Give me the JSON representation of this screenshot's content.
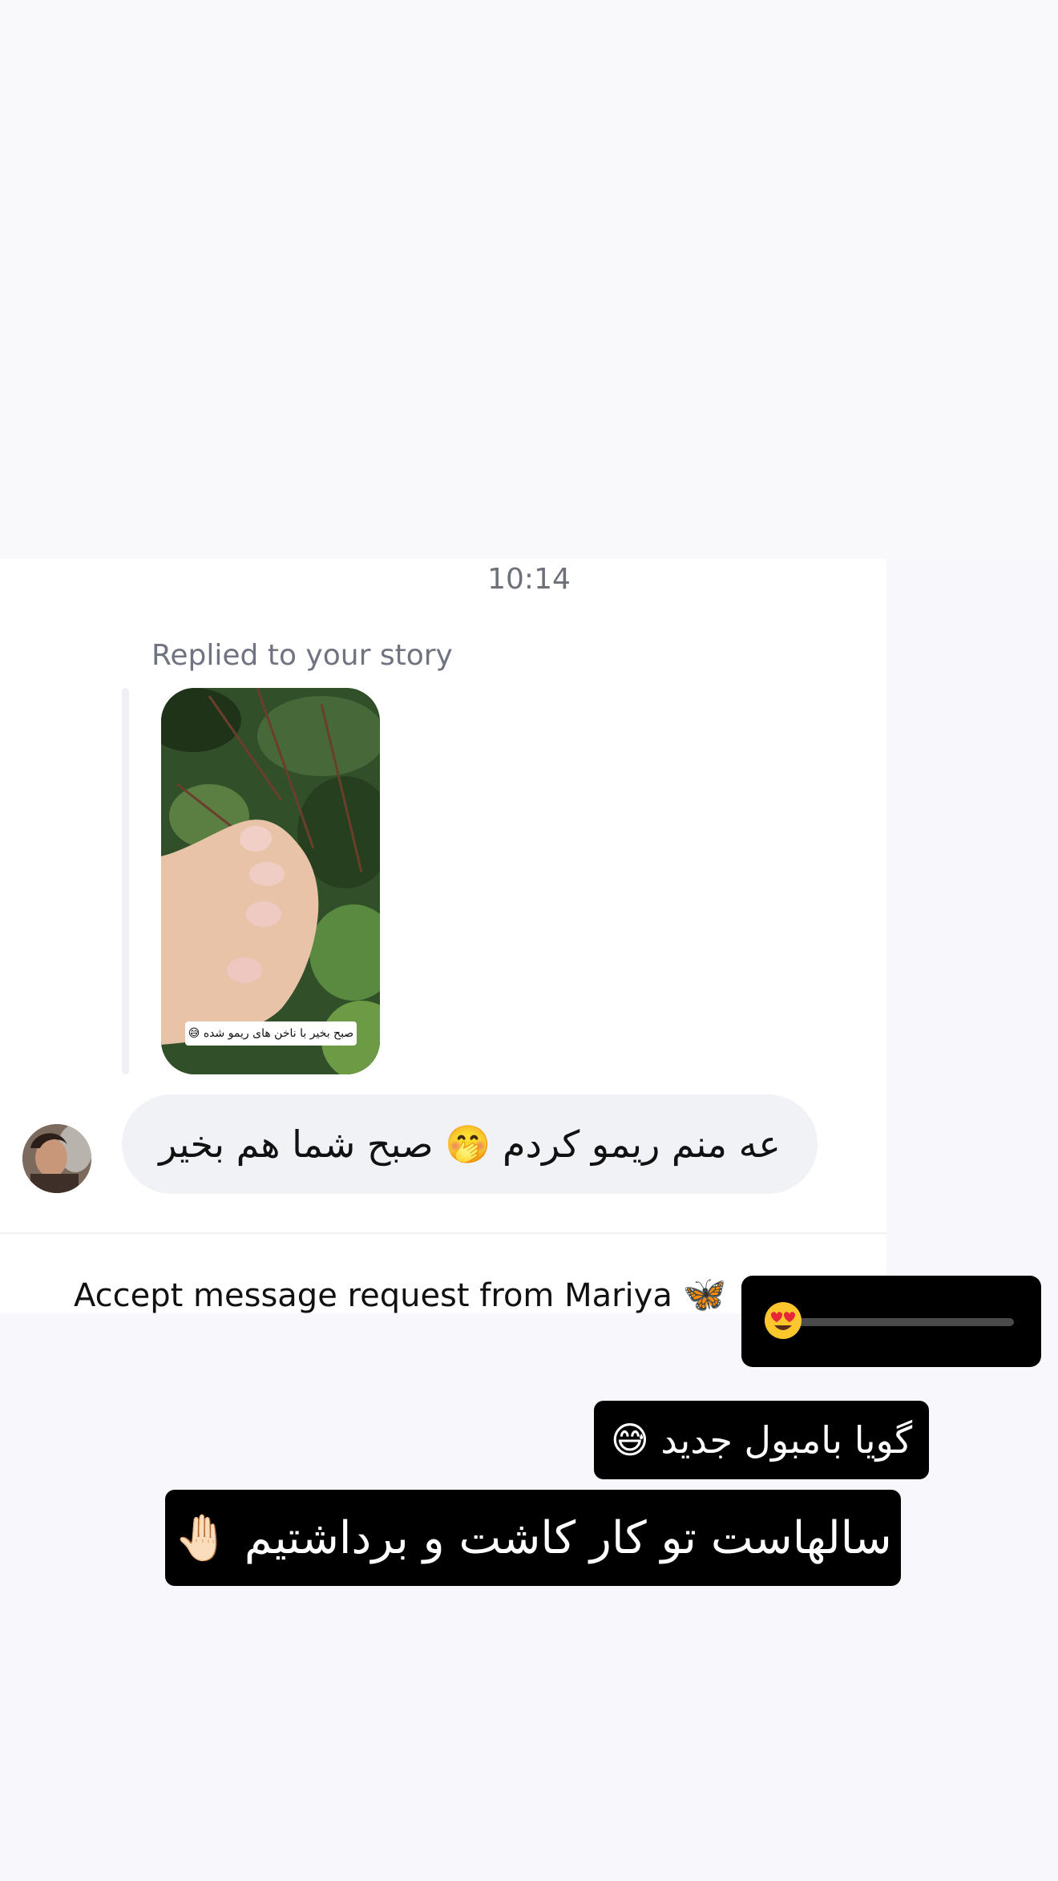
{
  "chat": {
    "timestamp": "10:14",
    "replied_label": "Replied to your story",
    "story_caption": "صبح بخیر با ناخن های ریمو شده 😅",
    "message": "عه منم ریمو کردم 🤭 صبح شما هم بخیر",
    "accept_request": {
      "text": "Accept message request from Mariya",
      "emoji": "🦋"
    }
  },
  "stickers": {
    "slider": {
      "emoji": "😍",
      "value_fraction": 0.0
    },
    "caption_1": "گویا بامبول جدید 😅",
    "caption_2": "سالهاست تو کار کاشت و برداشتیم 🤚🏻"
  },
  "colors": {
    "panel_bg": "#ffffff",
    "page_bg": "#f8f8fc",
    "bubble_bg": "#f1f2f6",
    "sticker_bg": "#000000",
    "muted_text": "#6f7480"
  }
}
